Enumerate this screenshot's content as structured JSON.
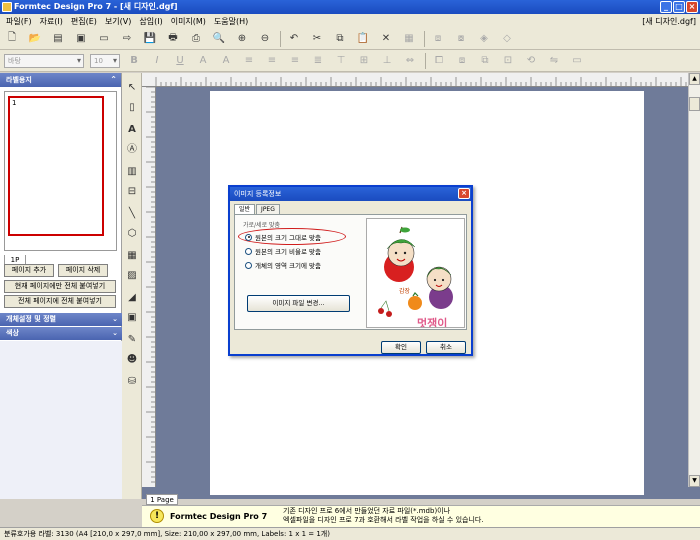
{
  "window": {
    "title": "Formtec Design Pro 7 - [새 디자인.dgf]",
    "doc_title": "[새 디자인.dgf]"
  },
  "menu": [
    "파일(F)",
    "자료(I)",
    "편집(E)",
    "보기(V)",
    "삽입(I)",
    "이미지(M)",
    "도움말(H)"
  ],
  "toolbar2": {
    "font_combo": "바탕",
    "size_combo": "10"
  },
  "left_panel": {
    "header": "라벨용지",
    "thumb_page_label": "1",
    "page_tab": "1P",
    "buttons": {
      "add_page": "페이지 추가",
      "delete_page": "페이지 삭제",
      "paste_current": "현재 페이지에만 전체 붙여넣기",
      "paste_all": "전체 페이지에 전체 붙여넣기"
    },
    "sections": [
      "개체설정 및 정렬",
      "색상"
    ]
  },
  "work_area": {
    "page_tab": "1 Page"
  },
  "hint": {
    "title": "Formtec Design Pro 7",
    "line1": "기존 디자인 프로 6에서 만들었던 자료 파일(*.mdb)이나",
    "line2": "엑셀파일을 디자인 프로 7과 호환해서 라벨 작업을 하실 수 있습니다."
  },
  "status": {
    "text": "분류호가용 라벨: 3130 (A4 [210,0 x 297,0 mm], Size: 210,00 x 297,00 mm,  Labels: 1 x 1 = 1개)"
  },
  "dialog": {
    "title": "이미지 등록정보",
    "tabs": [
      "일반",
      "JPEG"
    ],
    "group_label": "가로/세로 맞춤",
    "options": [
      "원본의 크기 그대로 맞춤",
      "원본의 크기 비율로 맞춤",
      "개체의 영역 크기에 맞춤"
    ],
    "selected_index": 0,
    "change_button": "이미지 파일 변경...",
    "ok": "확인",
    "cancel": "취소",
    "preview_caption": "멋쟁이"
  },
  "colors": {
    "title_blue": "#1a4bbf",
    "work_bg": "#6f7b99",
    "highlight": "#d01c1c"
  }
}
